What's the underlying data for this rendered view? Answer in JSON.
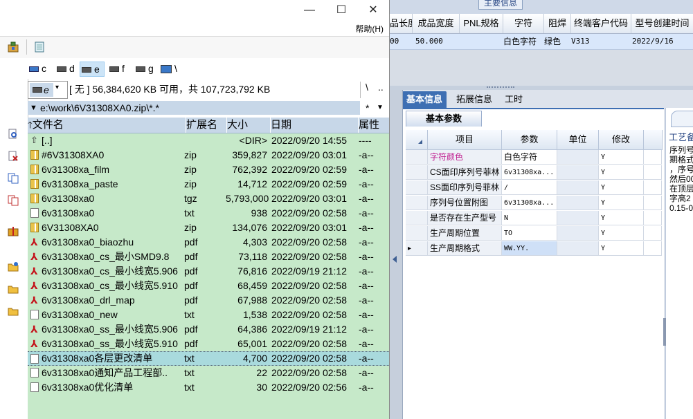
{
  "background_app": {
    "group_title": "主要信息",
    "grid_columns": [
      "品长度",
      "成品宽度",
      "PNL规格",
      "字符",
      "阻焊",
      "终端客户代码",
      "型号创建时间"
    ],
    "grid_row": [
      "00",
      "50.000",
      "",
      "白色字符",
      "绿色",
      "V313",
      "2022/9/16"
    ],
    "tabs": [
      "基本信息",
      "拓展信息",
      "工时"
    ],
    "subtab": "基本参数",
    "param_headers": [
      "项目",
      "参数",
      "单位",
      "修改"
    ],
    "params": [
      {
        "item": "字符颜色",
        "value": "白色字符",
        "unit": "",
        "mod": "Y",
        "highlight": true
      },
      {
        "item": "CS面印序列号菲林",
        "value": "6v31308xa...",
        "unit": "",
        "mod": "Y"
      },
      {
        "item": "SS面印序列号菲林",
        "value": "/",
        "unit": "",
        "mod": "Y"
      },
      {
        "item": "序列号位置附图",
        "value": "6v31308xa...",
        "unit": "",
        "mod": "Y"
      },
      {
        "item": "是否存在生产型号",
        "value": "N",
        "unit": "",
        "mod": "Y"
      },
      {
        "item": "生产周期位置",
        "value": "TO",
        "unit": "",
        "mod": "Y"
      },
      {
        "item": "生产周期格式",
        "value": "WW.YY.",
        "unit": "",
        "mod": "Y",
        "current": true
      }
    ],
    "side_title": "工艺备",
    "side_text": "序列号\n期格式\n，序号\n然后00\n在顶层\n字高2\n0.15-0"
  },
  "file_manager": {
    "window_controls": {
      "minimize": "—",
      "maximize": "☐",
      "close": "✕"
    },
    "menu_help": "帮助(H)",
    "drives": [
      "c",
      "d",
      "e",
      "f",
      "g",
      "\\"
    ],
    "panel_drive": "e",
    "free_info": "[ 无 ]  56,384,620 KB 可用，共 107,723,792 KB",
    "back_label": "\\",
    "up_label": "..",
    "path": "e:\\work\\6V31308XA0.zip\\*.*",
    "path_star": "*",
    "columns": {
      "name": "文件名",
      "ext": "扩展名",
      "size": "大小",
      "date": "日期",
      "attr": "属性"
    },
    "files": [
      {
        "icon": "up",
        "name": "[..]",
        "ext": "",
        "size": "<DIR>",
        "date": "2022/09/20 14:55",
        "attr": "----"
      },
      {
        "icon": "zip",
        "name": "#6V31308XA0",
        "ext": "zip",
        "size": "359,827",
        "date": "2022/09/20 03:01",
        "attr": "-a--"
      },
      {
        "icon": "zip",
        "name": "6v31308xa_film",
        "ext": "zip",
        "size": "762,392",
        "date": "2022/09/20 02:59",
        "attr": "-a--"
      },
      {
        "icon": "zip",
        "name": "6v31308xa_paste",
        "ext": "zip",
        "size": "14,712",
        "date": "2022/09/20 02:59",
        "attr": "-a--"
      },
      {
        "icon": "zip",
        "name": "6v31308xa0",
        "ext": "tgz",
        "size": "5,793,000",
        "date": "2022/09/20 03:01",
        "attr": "-a--"
      },
      {
        "icon": "txt",
        "name": "6v31308xa0",
        "ext": "txt",
        "size": "938",
        "date": "2022/09/20 02:58",
        "attr": "-a--"
      },
      {
        "icon": "zip",
        "name": "6V31308XA0",
        "ext": "zip",
        "size": "134,076",
        "date": "2022/09/20 03:01",
        "attr": "-a--"
      },
      {
        "icon": "pdf",
        "name": "6v31308xa0_biaozhu",
        "ext": "pdf",
        "size": "4,303",
        "date": "2022/09/20 02:58",
        "attr": "-a--"
      },
      {
        "icon": "pdf",
        "name": "6v31308xa0_cs_最小SMD9.8",
        "ext": "pdf",
        "size": "73,118",
        "date": "2022/09/20 02:58",
        "attr": "-a--"
      },
      {
        "icon": "pdf",
        "name": "6v31308xa0_cs_最小线宽5.906",
        "ext": "pdf",
        "size": "76,816",
        "date": "2022/09/19 21:12",
        "attr": "-a--"
      },
      {
        "icon": "pdf",
        "name": "6v31308xa0_cs_最小线宽5.910",
        "ext": "pdf",
        "size": "68,459",
        "date": "2022/09/20 02:58",
        "attr": "-a--"
      },
      {
        "icon": "pdf",
        "name": "6v31308xa0_drl_map",
        "ext": "pdf",
        "size": "67,988",
        "date": "2022/09/20 02:58",
        "attr": "-a--"
      },
      {
        "icon": "txt",
        "name": "6v31308xa0_new",
        "ext": "txt",
        "size": "1,538",
        "date": "2022/09/20 02:58",
        "attr": "-a--"
      },
      {
        "icon": "pdf",
        "name": "6v31308xa0_ss_最小线宽5.906",
        "ext": "pdf",
        "size": "64,386",
        "date": "2022/09/19 21:12",
        "attr": "-a--"
      },
      {
        "icon": "pdf",
        "name": "6v31308xa0_ss_最小线宽5.910",
        "ext": "pdf",
        "size": "65,001",
        "date": "2022/09/20 02:58",
        "attr": "-a--"
      },
      {
        "icon": "txt",
        "name": "6v31308xa0各层更改清单",
        "ext": "txt",
        "size": "4,700",
        "date": "2022/09/20 02:58",
        "attr": "-a--",
        "selected": true
      },
      {
        "icon": "txt",
        "name": "6v31308xa0通知产品工程部..",
        "ext": "txt",
        "size": "22",
        "date": "2022/09/20 02:58",
        "attr": "-a--"
      },
      {
        "icon": "txt",
        "name": "6v31308xa0优化清单",
        "ext": "txt",
        "size": "30",
        "date": "2022/09/20 02:56",
        "attr": "-a--"
      }
    ]
  },
  "colors": {
    "list_bg": "#c6e9c9",
    "selected_row": "#a9dadd",
    "header_bg": "#c7d7e8",
    "accent_tab": "#3e6fb3"
  }
}
